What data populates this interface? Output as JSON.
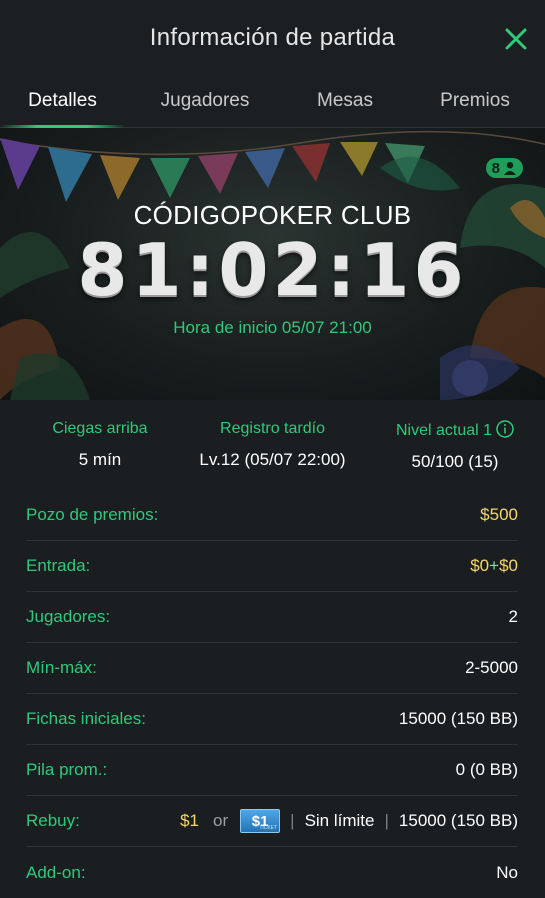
{
  "header": {
    "title": "Información de partida"
  },
  "tabs": [
    {
      "label": "Detalles"
    },
    {
      "label": "Jugadores"
    },
    {
      "label": "Mesas"
    },
    {
      "label": "Premios"
    }
  ],
  "banner": {
    "club_name": "CÓDIGOPOKER CLUB",
    "timer": "81:02:16",
    "start_time": "Hora de inicio 05/07 21:00",
    "badge_count": "8"
  },
  "stats": {
    "blinds_label": "Ciegas arriba",
    "blinds_value": "5 mín",
    "late_reg_label": "Registro tardío",
    "late_reg_value": "Lv.12 (05/07 22:00)",
    "level_label": "Nivel actual 1",
    "level_value": "50/100 (15)"
  },
  "rows": {
    "prize_pool": {
      "label": "Pozo de premios:",
      "value": "$500"
    },
    "buyin": {
      "label": "Entrada:",
      "value_a": "$0",
      "plus": "+",
      "value_b": "$0"
    },
    "players": {
      "label": "Jugadores:",
      "value": "2"
    },
    "minmax": {
      "label": "Mín-máx:",
      "value": "2-5000"
    },
    "starting_chips": {
      "label": "Fichas iniciales:",
      "value": "15000 (150 BB)"
    },
    "avg_stack": {
      "label": "Pila prom.:",
      "value": "0 (0 BB)"
    },
    "rebuy": {
      "label": "Rebuy:",
      "price": "$1",
      "or": "or",
      "ticket": "$1",
      "limit": "Sin límite",
      "chips": "15000 (150 BB)"
    },
    "addon": {
      "label": "Add-on:",
      "value": "No"
    }
  },
  "colors": {
    "accent": "#2fc97a",
    "gold": "#f5d76e",
    "background": "#1b1e21"
  }
}
